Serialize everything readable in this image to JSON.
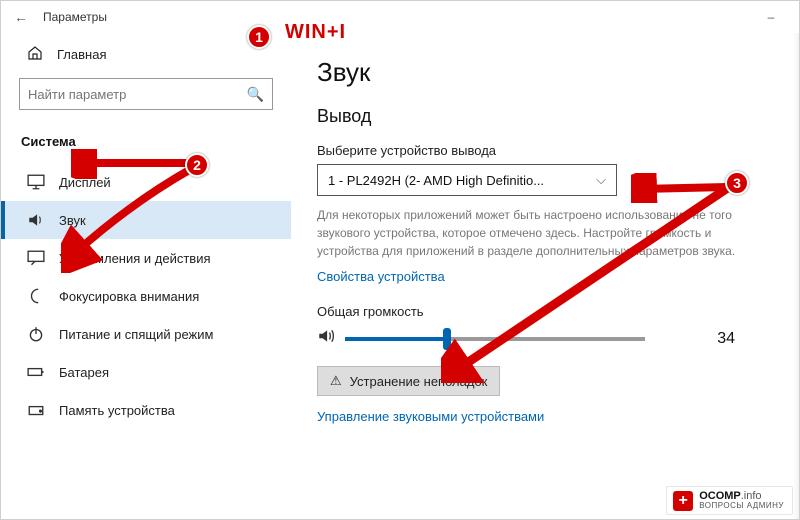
{
  "window": {
    "title": "Параметры"
  },
  "sidebar": {
    "home": "Главная",
    "search_placeholder": "Найти параметр",
    "group": "Система",
    "items": [
      {
        "label": "Дисплей",
        "icon": "display-icon"
      },
      {
        "label": "Звук",
        "icon": "speaker-icon",
        "active": true
      },
      {
        "label": "Уведомления и действия",
        "icon": "message-icon"
      },
      {
        "label": "Фокусировка внимания",
        "icon": "moon-icon"
      },
      {
        "label": "Питание и спящий режим",
        "icon": "power-icon"
      },
      {
        "label": "Батарея",
        "icon": "battery-icon"
      },
      {
        "label": "Память устройства",
        "icon": "storage-icon"
      }
    ]
  },
  "content": {
    "heading": "Звук",
    "section_output": "Вывод",
    "output_device_label": "Выберите устройство вывода",
    "output_device_value": "1 - PL2492H (2- AMD High Definitio...",
    "output_desc": "Для некоторых приложений может быть настроено использование не того звукового устройства, которое отмечено здесь. Настройте громкость и устройства для приложений в разделе дополнительных параметров звука.",
    "device_props_link": "Свойства устройства",
    "volume_label": "Общая громкость",
    "volume_value": "34",
    "volume_percent": 34,
    "troubleshoot": "Устранение неполадок",
    "manage_devices_link": "Управление звуковыми устройствами"
  },
  "annotations": {
    "b1": "1",
    "b2": "2",
    "b3": "3",
    "shortcut": "WIN+I"
  },
  "watermark": {
    "brand": "OCOMP",
    "tld": ".info",
    "tagline": "ВОПРОСЫ АДМИНУ"
  }
}
